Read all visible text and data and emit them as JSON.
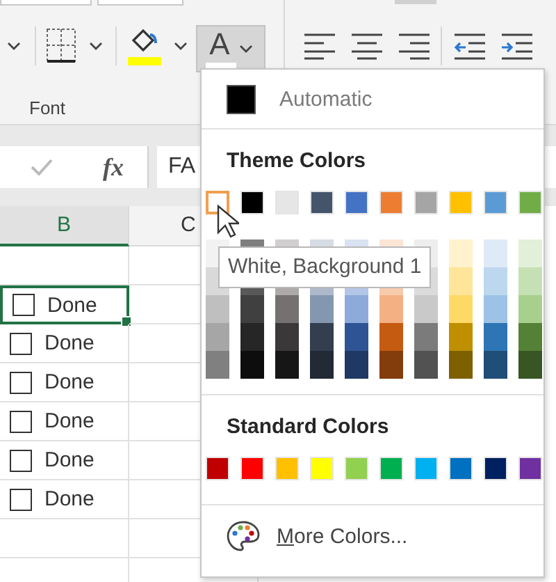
{
  "ribbon": {
    "group_label": "Font",
    "font_color_button": {
      "letter": "A"
    }
  },
  "formula_bar": {
    "fx": "fx",
    "value": "FA"
  },
  "sheet": {
    "columns": [
      {
        "label": "B",
        "selected": true
      },
      {
        "label": "C",
        "selected": false
      }
    ],
    "rows": [
      {
        "kind": "blank"
      },
      {
        "kind": "checkbox",
        "checked": false,
        "label": "Done",
        "selected": true
      },
      {
        "kind": "checkbox",
        "checked": false,
        "label": "Done",
        "selected": false
      },
      {
        "kind": "checkbox",
        "checked": false,
        "label": "Done",
        "selected": false
      },
      {
        "kind": "checkbox",
        "checked": false,
        "label": "Done",
        "selected": false
      },
      {
        "kind": "checkbox",
        "checked": false,
        "label": "Done",
        "selected": false
      },
      {
        "kind": "checkbox",
        "checked": false,
        "label": "Done",
        "selected": false
      },
      {
        "kind": "blank"
      },
      {
        "kind": "blank"
      }
    ]
  },
  "color_menu": {
    "automatic": "Automatic",
    "theme_heading": "Theme Colors",
    "theme_colors": [
      {
        "color": "#ffffff",
        "selected": true,
        "shades": [
          {
            "color": "#f2f2f2"
          },
          {
            "color": "#d9d9d9"
          },
          {
            "color": "#bfbfbf"
          },
          {
            "color": "#a6a6a6"
          },
          {
            "color": "#808080"
          }
        ]
      },
      {
        "color": "#000000",
        "selected": false,
        "shades": [
          {
            "color": "#7f7f7f"
          },
          {
            "color": "#595959"
          },
          {
            "color": "#404040"
          },
          {
            "color": "#262626"
          },
          {
            "color": "#0d0d0d"
          }
        ]
      },
      {
        "color": "#e7e6e6",
        "selected": false,
        "shades": [
          {
            "color": "#d0cece"
          },
          {
            "color": "#aeaaaa"
          },
          {
            "color": "#757171"
          },
          {
            "color": "#3a3838"
          },
          {
            "color": "#161616"
          }
        ]
      },
      {
        "color": "#44546a",
        "selected": false,
        "shades": [
          {
            "color": "#d6dce4"
          },
          {
            "color": "#adb9ca"
          },
          {
            "color": "#8497b0"
          },
          {
            "color": "#333f4f"
          },
          {
            "color": "#222a35"
          }
        ]
      },
      {
        "color": "#4472c4",
        "selected": false,
        "shades": [
          {
            "color": "#d9e2f3"
          },
          {
            "color": "#b4c6e7"
          },
          {
            "color": "#8eaadb"
          },
          {
            "color": "#2f5496"
          },
          {
            "color": "#1f3864"
          }
        ]
      },
      {
        "color": "#ed7d31",
        "selected": false,
        "shades": [
          {
            "color": "#fbe5d5"
          },
          {
            "color": "#f7caac"
          },
          {
            "color": "#f4b083"
          },
          {
            "color": "#c55a11"
          },
          {
            "color": "#833c0b"
          }
        ]
      },
      {
        "color": "#a5a5a5",
        "selected": false,
        "shades": [
          {
            "color": "#ededed"
          },
          {
            "color": "#dbdbdb"
          },
          {
            "color": "#c9c9c9"
          },
          {
            "color": "#7b7b7b"
          },
          {
            "color": "#525252"
          }
        ]
      },
      {
        "color": "#ffc000",
        "selected": false,
        "shades": [
          {
            "color": "#fff2cc"
          },
          {
            "color": "#fee599"
          },
          {
            "color": "#ffd966"
          },
          {
            "color": "#bf8f00"
          },
          {
            "color": "#7f6000"
          }
        ]
      },
      {
        "color": "#5b9bd5",
        "selected": false,
        "shades": [
          {
            "color": "#deeaf6"
          },
          {
            "color": "#bdd7ee"
          },
          {
            "color": "#9cc3e5"
          },
          {
            "color": "#2e75b5"
          },
          {
            "color": "#1f4e79"
          }
        ]
      },
      {
        "color": "#70ad47",
        "selected": false,
        "shades": [
          {
            "color": "#e2efd9"
          },
          {
            "color": "#c5e0b3"
          },
          {
            "color": "#a8d08d"
          },
          {
            "color": "#538135"
          },
          {
            "color": "#375623"
          }
        ]
      }
    ],
    "standard_heading": "Standard Colors",
    "standard_colors": [
      {
        "color": "#c00000"
      },
      {
        "color": "#ff0000"
      },
      {
        "color": "#ffc000"
      },
      {
        "color": "#ffff00"
      },
      {
        "color": "#92d050"
      },
      {
        "color": "#00b050"
      },
      {
        "color": "#00b0f0"
      },
      {
        "color": "#0070c0"
      },
      {
        "color": "#002060"
      },
      {
        "color": "#7030a0"
      }
    ],
    "more_colors": "More Colors..."
  },
  "tooltip": "White, Background 1"
}
